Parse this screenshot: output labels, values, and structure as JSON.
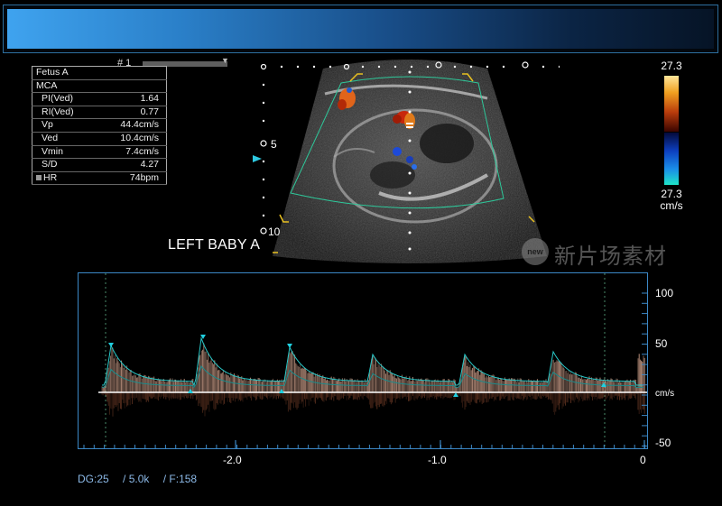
{
  "probe": {
    "label": "# 1"
  },
  "measurements": {
    "rows": [
      {
        "label": "Fetus A",
        "value": ""
      },
      {
        "label": "MCA",
        "value": ""
      },
      {
        "label": "PI(Ved)",
        "value": "1.64"
      },
      {
        "label": "RI(Ved)",
        "value": "0.77"
      },
      {
        "label": "Vp",
        "value": "44.4cm/s"
      },
      {
        "label": "Ved",
        "value": "10.4cm/s"
      },
      {
        "label": "Vmin",
        "value": "7.4cm/s"
      },
      {
        "label": "S/D",
        "value": "4.27"
      },
      {
        "label": "HR",
        "value": "74bpm"
      }
    ]
  },
  "image": {
    "depth_marker_1": "5",
    "depth_marker_2": "10",
    "annotation": "LEFT BABY A"
  },
  "color_scale": {
    "top_value": "27.3",
    "bottom_value": "27.3",
    "unit": "cm/s",
    "top_color": "#f0a020",
    "bottom_color": "#1a8ee8"
  },
  "watermark": {
    "logo_text": "new",
    "text": "新片场素材"
  },
  "spectral": {
    "y_ticks": [
      "100",
      "50",
      "cm/s",
      "-50"
    ],
    "x_ticks": [
      "-2.0",
      "-1.0",
      "0"
    ],
    "waveform_color": "#e8b49c",
    "envelope_color": "#28c8c8",
    "peak_marker_color": "#20d0e0"
  },
  "footer": {
    "dg": "DG:25",
    "prf": "/ 5.0k",
    "filter": "/ F:158"
  }
}
